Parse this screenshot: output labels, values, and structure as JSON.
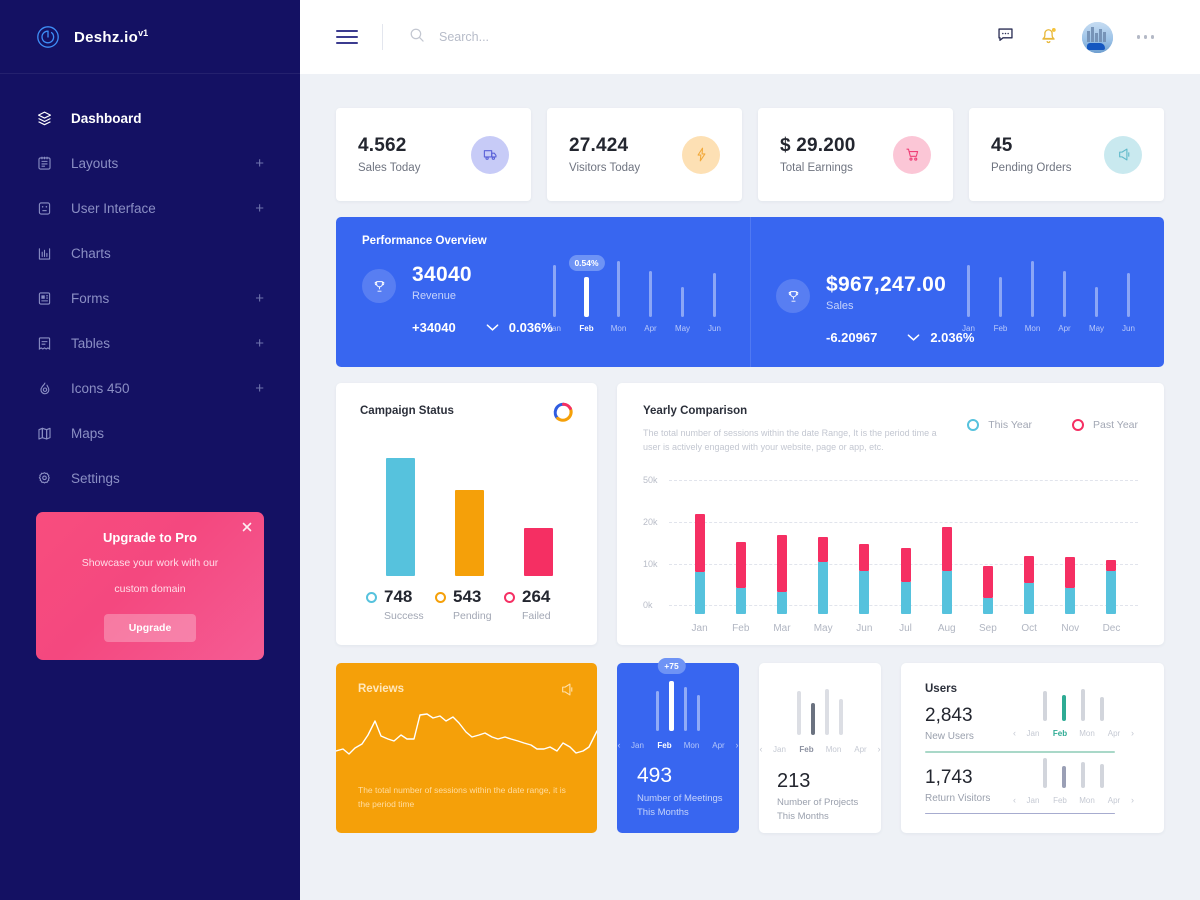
{
  "brand": {
    "name": "Deshz.io",
    "version": "v1",
    "logo_icon": "power-circle-icon"
  },
  "sidebar": {
    "items": [
      {
        "label": "Dashboard",
        "icon": "layers-icon",
        "plus": "",
        "active": true
      },
      {
        "label": "Layouts",
        "icon": "notebook-icon",
        "plus": "+",
        "active": false
      },
      {
        "label": "User Interface",
        "icon": "robot-icon",
        "plus": "+",
        "active": false
      },
      {
        "label": "Charts",
        "icon": "bar-chart-icon",
        "plus": "",
        "active": false
      },
      {
        "label": "Forms",
        "icon": "form-icon",
        "plus": "+",
        "active": false
      },
      {
        "label": "Tables",
        "icon": "table-icon",
        "plus": "+",
        "active": false
      },
      {
        "label": "Icons 450",
        "icon": "flame-icon",
        "plus": "+",
        "active": false
      },
      {
        "label": "Maps",
        "icon": "map-icon",
        "plus": "",
        "active": false
      },
      {
        "label": "Settings",
        "icon": "gear-icon",
        "plus": "",
        "active": false
      }
    ],
    "upgrade": {
      "title": "Upgrade to Pro",
      "line1": "Showcase your work with our",
      "line2": "custom domain",
      "button": "Upgrade",
      "close_icon": "close-icon"
    }
  },
  "topbar": {
    "menu_icon": "hamburger-icon",
    "search_icon": "search-icon",
    "search_placeholder": "Search...",
    "search_value": "",
    "message_icon": "message-icon",
    "bell_icon": "bell-icon",
    "avatar_icon": "user-avatar",
    "more_icon": "more-dots-icon"
  },
  "stats": [
    {
      "value": "4.562",
      "label": "Sales Today",
      "icon": "truck-icon",
      "bubble_bg": "#c7cbf7",
      "icon_color": "#5b62d8"
    },
    {
      "value": "27.424",
      "label": "Visitors Today",
      "icon": "bolt-icon",
      "bubble_bg": "#fde0b4",
      "icon_color": "#f2a93b"
    },
    {
      "value": "$ 29.200",
      "label": "Total Earnings",
      "icon": "cart-icon",
      "bubble_bg": "#fbc6d6",
      "icon_color": "#ef3f77"
    },
    {
      "value": "45",
      "label": "Pending Orders",
      "icon": "megaphone-icon",
      "bubble_bg": "#c9e9ef",
      "icon_color": "#5fb9c9"
    }
  ],
  "performance": {
    "title": "Performance Overview",
    "panels": [
      {
        "icon": "trophy-icon",
        "value": "34040",
        "label": "Revenue",
        "delta": "+34040",
        "percent": "0.036%",
        "caret_icon": "chevron-down-icon",
        "badge": "0.54%",
        "months": [
          "Jan",
          "Feb",
          "Mon",
          "Apr",
          "May",
          "Jun"
        ],
        "heights": [
          52,
          40,
          56,
          46,
          30,
          44
        ],
        "highlight_index": 1
      },
      {
        "icon": "trophy-icon",
        "value": "$967,247.00",
        "label": "Sales",
        "delta": "-6.20967",
        "percent": "2.036%",
        "caret_icon": "chevron-down-icon",
        "badge": "",
        "months": [
          "Jan",
          "Feb",
          "Mon",
          "Apr",
          "May",
          "Jun"
        ],
        "heights": [
          52,
          40,
          56,
          46,
          30,
          44
        ],
        "highlight_index": -1
      }
    ]
  },
  "campaign": {
    "title": "Campaign Status",
    "donut_icon": "donut-chart-icon",
    "chart_data": {
      "type": "bar",
      "title": "Campaign Status",
      "categories": [
        "Success",
        "Pending",
        "Failed"
      ],
      "values": [
        748,
        543,
        264
      ],
      "colors": [
        "#56c2dd",
        "#f5a009",
        "#f52f63"
      ],
      "xlabel": "",
      "ylabel": "",
      "ylim": [
        0,
        800
      ]
    },
    "items": [
      {
        "num": "748",
        "name": "Success",
        "color": "#56c2dd"
      },
      {
        "num": "543",
        "name": "Pending",
        "color": "#f5a009"
      },
      {
        "num": "264",
        "name": "Failed",
        "color": "#f52f63"
      }
    ]
  },
  "yearly": {
    "title": "Yearly Comparison",
    "description": "The total number of sessions within the date Range, It is the period time a user is actively engaged with your website, page or app, etc.",
    "legend": [
      {
        "label": "This Year",
        "color": "#56c2dd"
      },
      {
        "label": "Past Year",
        "color": "#f52f63"
      }
    ],
    "chart_data": {
      "type": "bar",
      "title": "Yearly Comparison",
      "categories": [
        "Jan",
        "Feb",
        "Mar",
        "May",
        "Jun",
        "Jul",
        "Aug",
        "Sep",
        "Oct",
        "Nov",
        "Dec"
      ],
      "ytick_labels": [
        "0k",
        "10k",
        "20k",
        "50k"
      ],
      "ytick_positions": [
        0,
        10000,
        20000,
        50000
      ],
      "ylim": [
        0,
        50000
      ],
      "grid": true,
      "legend_position": "top-right",
      "series": [
        {
          "name": "This Year",
          "color": "#56c2dd",
          "values": [
            14500,
            8500,
            7200,
            17500,
            14700,
            10800,
            14600,
            5400,
            10700,
            8700,
            14600
          ]
        },
        {
          "name": "Past Year",
          "color": "#f52f63",
          "values": [
            28500,
            19000,
            22200,
            25500,
            22800,
            21500,
            28800,
            16000,
            19700,
            19200,
            18500
          ]
        }
      ],
      "xlabel": "",
      "ylabel": ""
    }
  },
  "reviews": {
    "title": "Reviews",
    "icon": "megaphone-icon",
    "text": "The total number of sessions within the date range, it is the period time",
    "chart_data": {
      "type": "line",
      "title": "Reviews",
      "values": [
        30,
        28,
        36,
        30,
        38,
        46,
        62,
        48,
        44,
        42,
        48,
        44,
        44,
        70,
        72,
        66,
        68,
        62,
        66,
        60,
        52,
        46,
        48,
        50,
        46,
        44,
        46,
        44,
        42,
        40,
        38,
        34,
        34,
        36,
        32,
        40,
        36,
        30,
        32,
        36,
        52
      ],
      "color": "#ffffff"
    }
  },
  "meetings": {
    "badge": "+75",
    "months": [
      "Jan",
      "Feb",
      "Mon",
      "Apr"
    ],
    "heights": [
      40,
      50,
      44,
      36
    ],
    "highlight_index": 1,
    "prev_icon": "chevron-left-icon",
    "next_icon": "chevron-right-icon",
    "value": "493",
    "label_line1": "Number of Meetings",
    "label_line2": "This Months"
  },
  "projects": {
    "months": [
      "Jan",
      "Feb",
      "Mon",
      "Apr"
    ],
    "heights": [
      44,
      32,
      46,
      36
    ],
    "highlight_index": 1,
    "prev_icon": "chevron-left-icon",
    "next_icon": "chevron-right-icon",
    "value": "213",
    "label_line1": "Number of Projects",
    "label_line2": "This Months"
  },
  "users": {
    "title": "Users",
    "blocks": [
      {
        "value": "2,843",
        "label": "New Users",
        "rule_color": "#a9d8c8",
        "months": [
          "Jan",
          "Feb",
          "Mon",
          "Apr"
        ],
        "heights": [
          30,
          26,
          32,
          24
        ],
        "highlight_index": 1,
        "highlight_color": "#2eab94",
        "prev_icon": "chevron-left-icon",
        "next_icon": "chevron-right-icon"
      },
      {
        "value": "1,743",
        "label": "Return Visitors",
        "rule_color": "#a7accf",
        "months": [
          "Jan",
          "Feb",
          "Mon",
          "Apr"
        ],
        "heights": [
          30,
          22,
          26,
          24
        ],
        "highlight_index": 1,
        "highlight_color": "#9a9fb5",
        "prev_icon": "chevron-left-icon",
        "next_icon": "chevron-right-icon"
      }
    ]
  },
  "colors": {
    "sidebar_bg": "#141163",
    "accent_blue": "#3866f0",
    "accent_pink": "#f52f63",
    "accent_orange": "#f5a009",
    "accent_cyan": "#56c2dd",
    "page_bg": "#eef1f6"
  }
}
